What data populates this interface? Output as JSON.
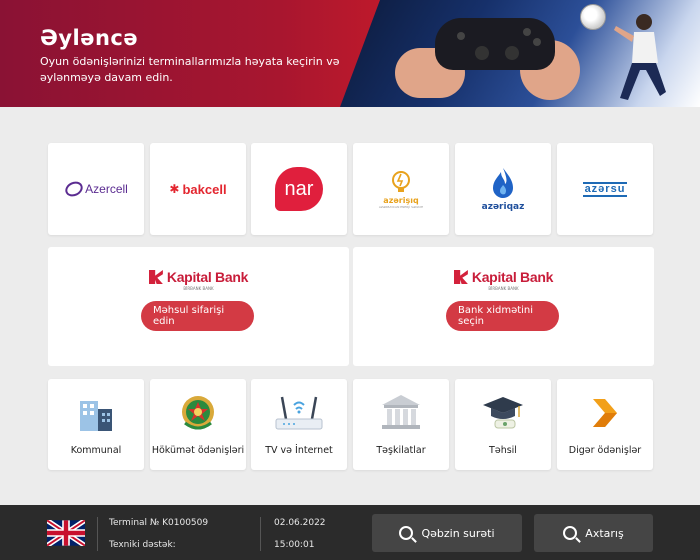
{
  "banner": {
    "title": "Əyləncə",
    "subtitle": "Oyun ödənişlərinizi terminallarımızla həyata keçirin və əylənməyə davam edin."
  },
  "providers": [
    {
      "name": "Azercell"
    },
    {
      "name": "bakcell"
    },
    {
      "name": "nar"
    },
    {
      "name": "azərişıq",
      "sub": "AZƏRBAYCAN ENERJİ SƏNAYE"
    },
    {
      "name": "azəriqaz"
    },
    {
      "name": "azərsu"
    }
  ],
  "banks": [
    {
      "logo": "Kapital Bank",
      "logo_sub": "BİRBANK BANK",
      "button": "Məhsul sifarişi edin"
    },
    {
      "logo": "Kapital Bank",
      "logo_sub": "BİRBANK BANK",
      "button": "Bank xidmətini seçin"
    }
  ],
  "categories": [
    {
      "label": "Kommunal",
      "icon": "building-icon"
    },
    {
      "label": "Hökümət ödənişləri",
      "icon": "emblem-icon"
    },
    {
      "label": "TV və İnternet",
      "icon": "router-icon"
    },
    {
      "label": "Təşkilatlar",
      "icon": "institution-icon"
    },
    {
      "label": "Təhsil",
      "icon": "graduation-cap-icon"
    },
    {
      "label": "Digər ödənişlər",
      "icon": "chevron-right-icon"
    }
  ],
  "footer": {
    "terminal": "Terminal № K0100509",
    "support": "Texniki dəstək:",
    "date": "02.06.2022",
    "time": "15:00:01",
    "receipt_button": "Qəbzin surəti",
    "search_button": "Axtarış"
  },
  "colors": {
    "brand_red": "#d33a44",
    "banner_red": "#a8162f",
    "footer_bg": "#2b2b2b"
  }
}
